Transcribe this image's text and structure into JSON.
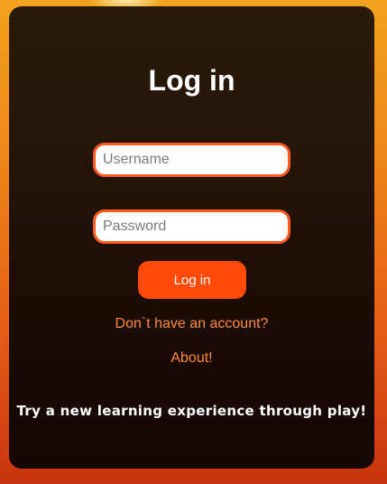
{
  "login": {
    "title": "Log in",
    "username_placeholder": "Username",
    "username_value": "",
    "password_placeholder": "Password",
    "password_value": "",
    "submit_label": "Log in",
    "signup_link": "Don`t have an account?",
    "about_link": "About!",
    "tagline": "Try a new learning experience through play!"
  },
  "colors": {
    "accent": "#ff4a0a",
    "link": "#ff8a3d",
    "card_background": "#1f0f06",
    "page_background": "#ee8418"
  }
}
